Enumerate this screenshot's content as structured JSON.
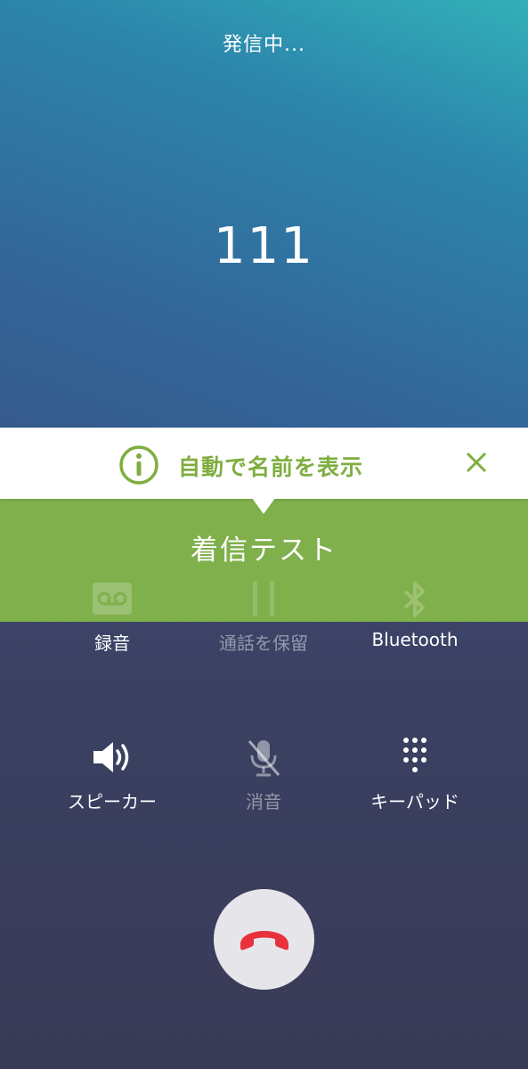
{
  "call": {
    "status": "発信中...",
    "number": "111"
  },
  "banner": {
    "icon": "info-circle-icon",
    "text": "自動で名前を表示",
    "close_icon": "close-icon",
    "accent_color": "#7fae3f"
  },
  "caller": {
    "name": "着信テスト",
    "background_color": "#80b04c"
  },
  "controls": {
    "row1": [
      {
        "label": "録音",
        "icon": "voicemail-icon",
        "enabled": true
      },
      {
        "label": "通話を保留",
        "icon": "pause-icon",
        "enabled": false
      },
      {
        "label": "Bluetooth",
        "icon": "bluetooth-icon",
        "enabled": true
      }
    ],
    "row2": [
      {
        "label": "スピーカー",
        "icon": "speaker-icon",
        "enabled": true
      },
      {
        "label": "消音",
        "icon": "mic-off-icon",
        "enabled": false
      },
      {
        "label": "キーパッド",
        "icon": "keypad-icon",
        "enabled": true
      }
    ]
  },
  "end_call": {
    "icon": "end-call-icon",
    "color": "#e8313a"
  }
}
